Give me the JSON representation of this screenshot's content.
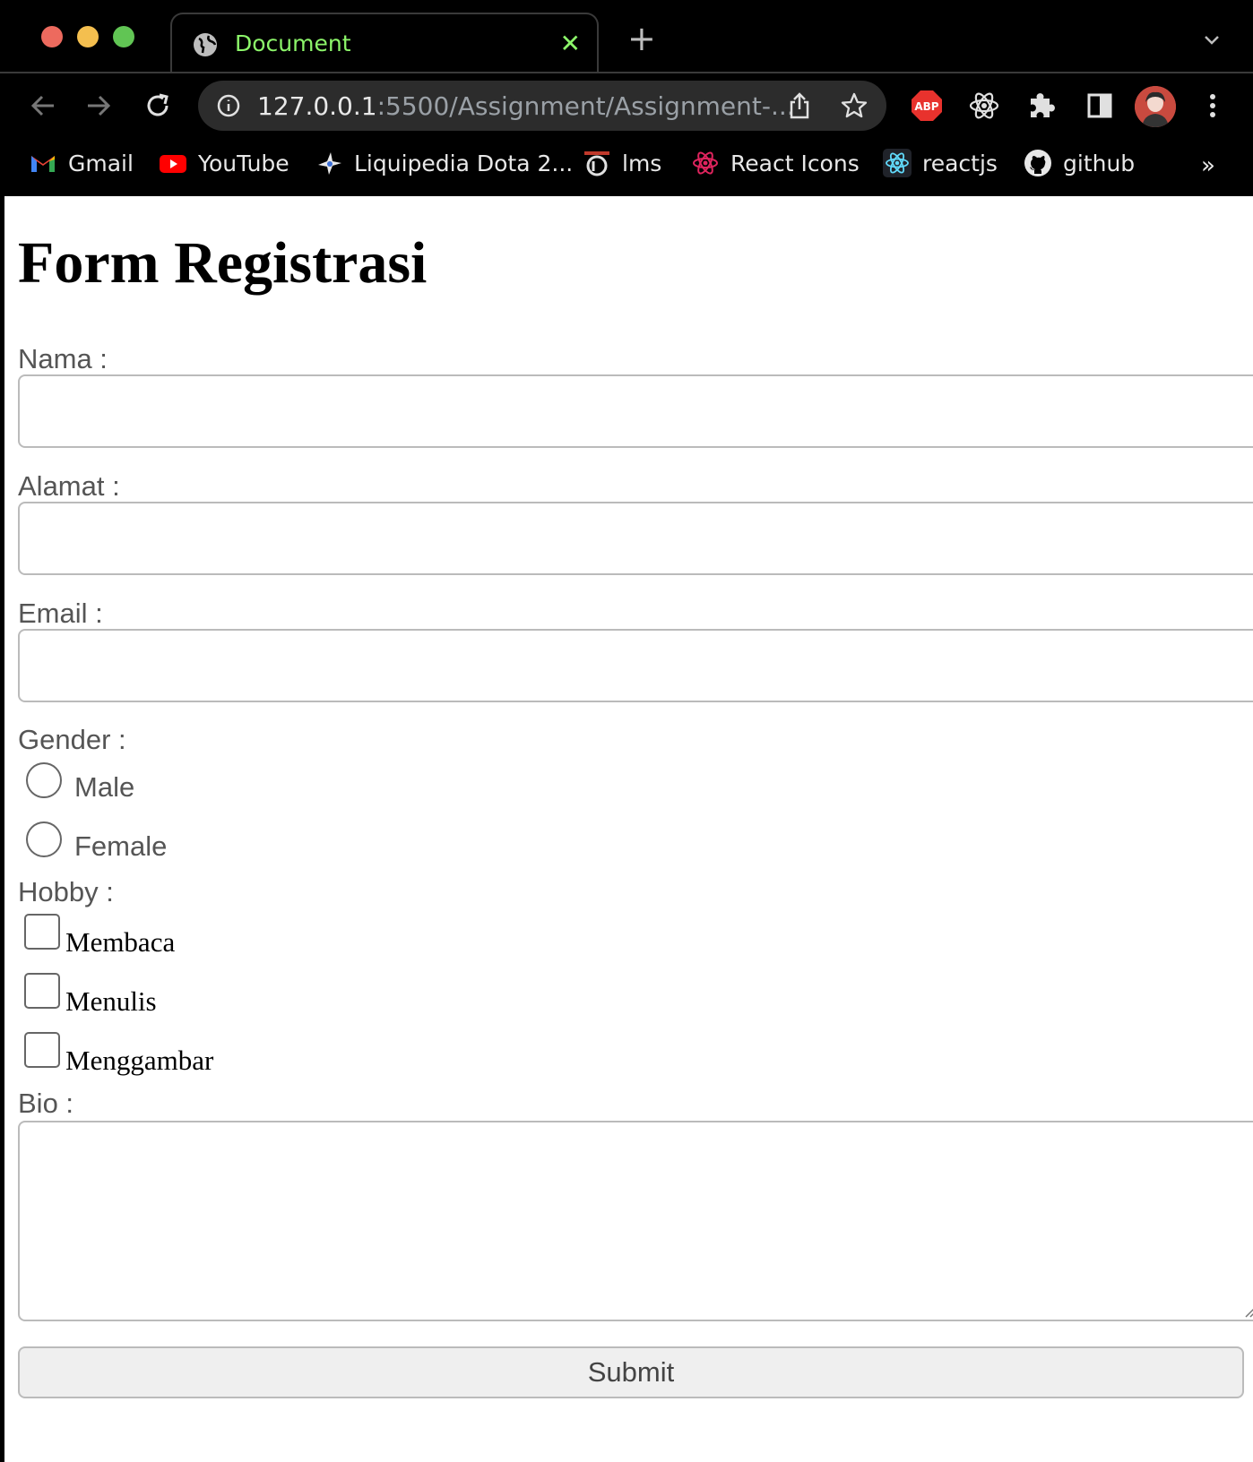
{
  "browser": {
    "tab": {
      "title": "Document",
      "close": "✕"
    },
    "new_tab": "+",
    "address": {
      "host": "127.0.0.1",
      "rest": ":5500/Assignment/Assignment-..."
    },
    "extensions": {
      "abp": "ABP"
    },
    "bookmarks": [
      {
        "label": "Gmail",
        "icon": "gmail-icon"
      },
      {
        "label": "YouTube",
        "icon": "youtube-icon"
      },
      {
        "label": "Liquipedia Dota 2...",
        "icon": "liquipedia-icon"
      },
      {
        "label": "lms",
        "icon": "lms-icon"
      },
      {
        "label": "React Icons",
        "icon": "react-icons-icon"
      },
      {
        "label": "reactjs",
        "icon": "react-icon"
      },
      {
        "label": "github",
        "icon": "github-icon"
      }
    ],
    "bookmarks_more": "»"
  },
  "form": {
    "title": "Form Registrasi",
    "nama_label": "Nama :",
    "nama_value": "",
    "alamat_label": "Alamat :",
    "alamat_value": "",
    "email_label": "Email :",
    "email_value": "",
    "gender_label": "Gender :",
    "gender_options": [
      "Male",
      "Female"
    ],
    "hobby_label": "Hobby :",
    "hobby_options": [
      "Membaca",
      "Menulis",
      "Menggambar"
    ],
    "bio_label": "Bio :",
    "bio_value": "",
    "submit_label": "Submit"
  },
  "colors": {
    "tab_accent": "#8cf56a",
    "chrome_bg": "#000000",
    "omnibox_bg": "#2c2c2c",
    "label_text": "#555555"
  }
}
